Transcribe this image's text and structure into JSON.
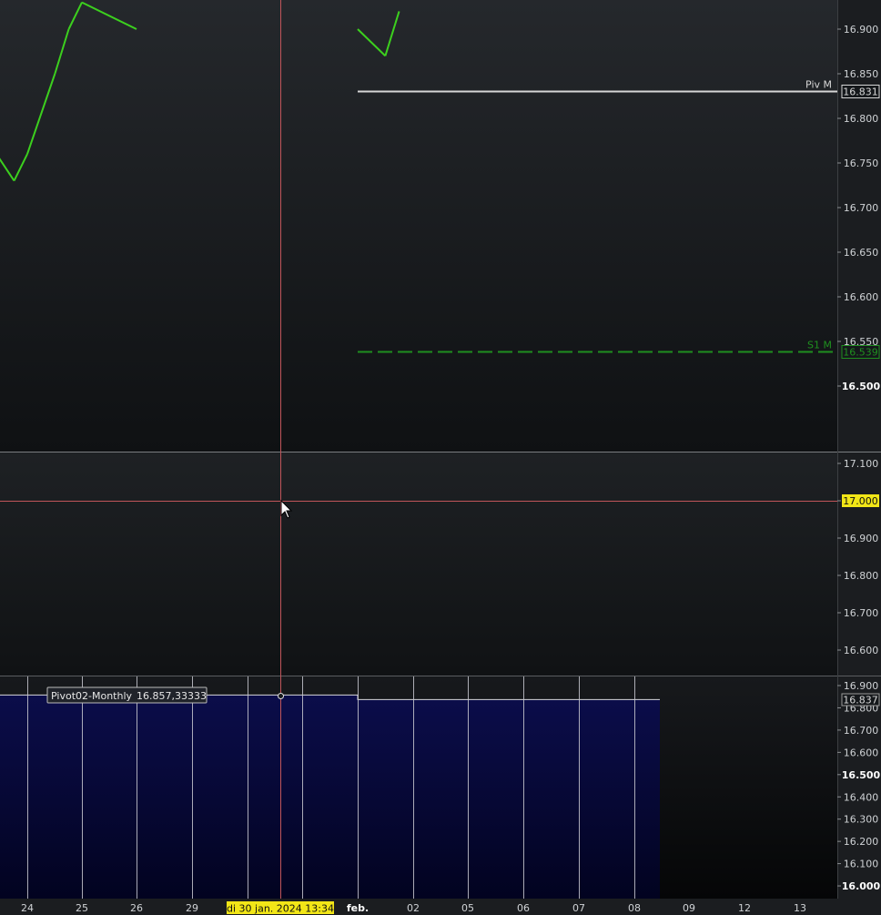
{
  "chart_data": [
    {
      "pane": "price",
      "type": "line",
      "y_ticks": [
        "16.900",
        "16.850",
        "16.800",
        "16.750",
        "16.700",
        "16.650",
        "16.600",
        "16.550",
        "16.500"
      ],
      "levels": [
        {
          "label": "Piv M",
          "value": 16831,
          "value_text": "16.831",
          "color": "#d7d7d7",
          "style": "solid"
        },
        {
          "label": "S1 M",
          "value": 16539,
          "value_text": "16.539",
          "color": "#1f8f1f",
          "style": "dashed"
        }
      ],
      "series": [
        {
          "values": [
            {
              "x": "2024-01-23",
              "y": 16800
            },
            {
              "x": "2024-01-23 18:00",
              "y": 16730
            },
            {
              "x": "2024-01-24",
              "y": 16760
            },
            {
              "x": "2024-01-24 12:00",
              "y": 16850
            },
            {
              "x": "2024-01-24 18:00",
              "y": 16900
            },
            {
              "x": "2024-01-25",
              "y": 16930
            },
            {
              "x": "2024-01-26",
              "y": 16900
            },
            {
              "x": "2024-02-01",
              "y": 16900
            },
            {
              "x": "2024-02-01 12:00",
              "y": 16870
            },
            {
              "x": "2024-02-01 18:00",
              "y": 16920
            }
          ]
        }
      ]
    },
    {
      "pane": "indicator",
      "type": "line",
      "y_ticks": [
        "17.100",
        "17.000",
        "16.900",
        "16.800",
        "16.700",
        "16.600"
      ],
      "cursor_value": "17.000"
    },
    {
      "pane": "pivot",
      "type": "area",
      "y_ticks": [
        "16.900",
        "16.800",
        "16.700",
        "16.600",
        "16.500",
        "16.400",
        "16.300",
        "16.200",
        "16.100",
        "16.000"
      ],
      "series": [
        {
          "name": "Pivot02-Monthly",
          "values": [
            {
              "x": "2024-01",
              "y": 16857.33333
            },
            {
              "x": "2024-02",
              "y": 16837
            }
          ]
        }
      ],
      "tooltip": {
        "name": "Pivot02-Monthly",
        "value": "16.857,33333"
      },
      "last_value": "16.837"
    }
  ],
  "x_axis": {
    "ticks": [
      "24",
      "25",
      "26",
      "29",
      "feb.",
      "02",
      "05",
      "06",
      "07",
      "08",
      "09",
      "12",
      "13"
    ],
    "cursor_label": "di 30 jan. 2024 13:34"
  }
}
